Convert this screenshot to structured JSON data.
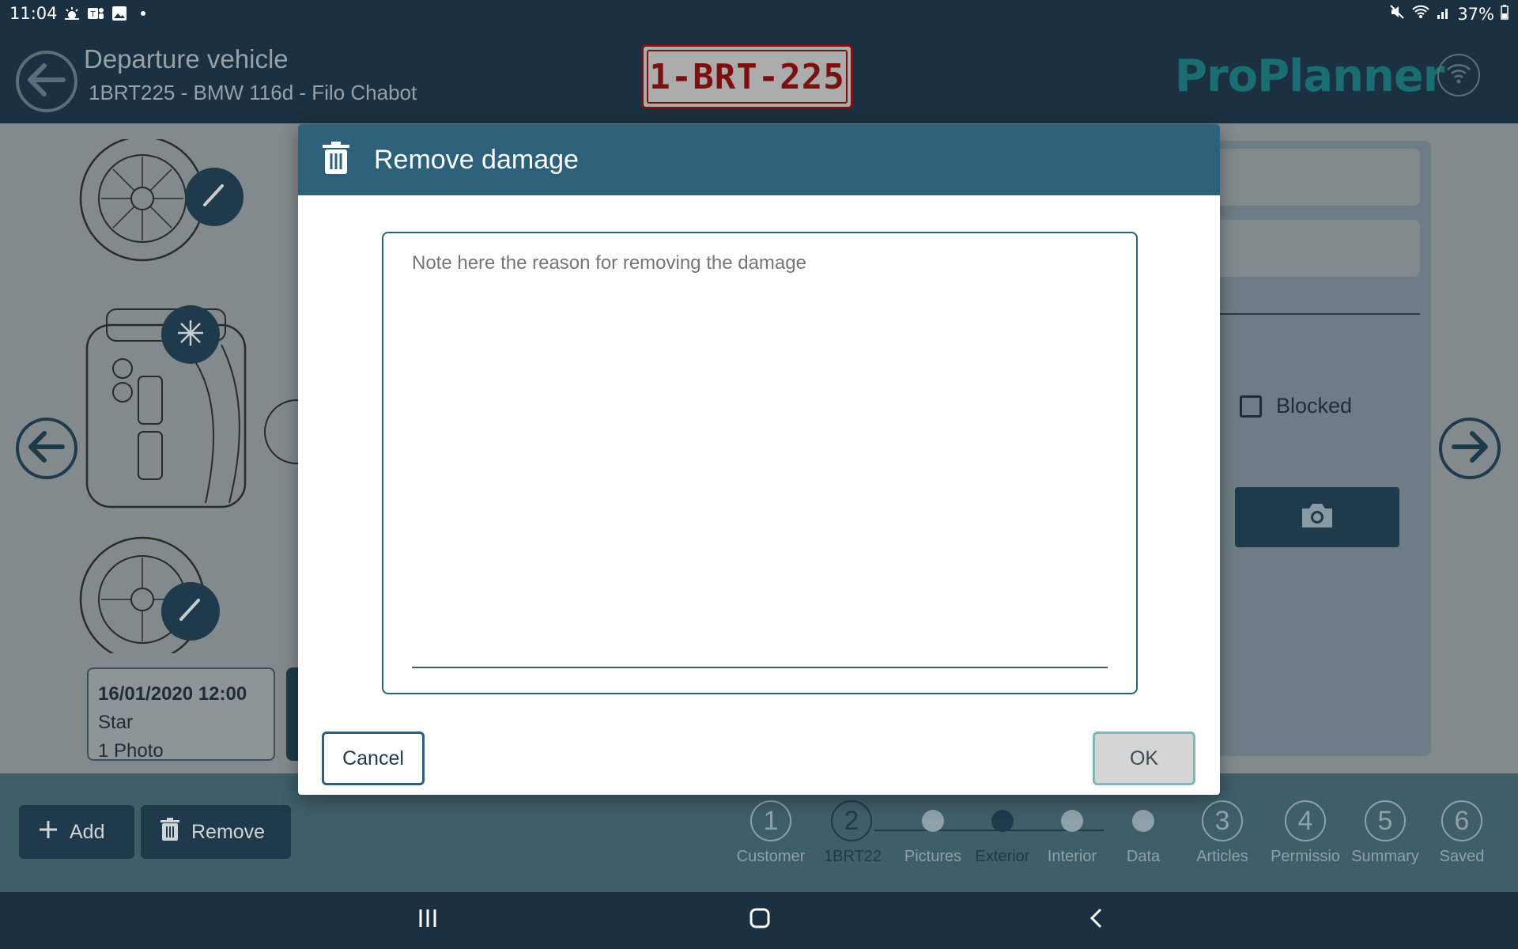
{
  "status": {
    "time": "11:04",
    "battery": "37%",
    "icons": [
      "weather-icon",
      "teams-icon",
      "gallery-icon",
      "dot-icon"
    ],
    "right_icons": [
      "mute-icon",
      "wifi-icon",
      "signal-icon",
      "battery-icon"
    ]
  },
  "header": {
    "title": "Departure vehicle",
    "subtitle": "1BRT225 - BMW 116d - Filo Chabot",
    "plate": "1-BRT-225",
    "logo": "ProPlanner"
  },
  "background": {
    "damage_card": {
      "date": "16/01/2020 12:00",
      "type": "Star",
      "photos": "1 Photo"
    },
    "blocked_label": "Blocked"
  },
  "bottom": {
    "add_label": "Add",
    "remove_label": "Remove",
    "steps": [
      {
        "num": "1",
        "label": "Customer"
      },
      {
        "num": "2",
        "label": "1BRT22"
      },
      {
        "num": "3",
        "label": "Articles"
      },
      {
        "num": "4",
        "label": "Permissio"
      },
      {
        "num": "5",
        "label": "Summary"
      },
      {
        "num": "6",
        "label": "Saved"
      }
    ],
    "substeps": [
      "Pictures",
      "Exterior",
      "Interior",
      "Data"
    ],
    "current_substep": "Exterior"
  },
  "modal": {
    "title": "Remove damage",
    "placeholder": "Note here the reason for removing the damage",
    "value": "",
    "cancel_label": "Cancel",
    "ok_label": "OK"
  },
  "colors": {
    "header_bg": "#1b3040",
    "modal_header": "#2d6179",
    "accent": "#1a6e72",
    "plate_red": "#7a1010"
  }
}
